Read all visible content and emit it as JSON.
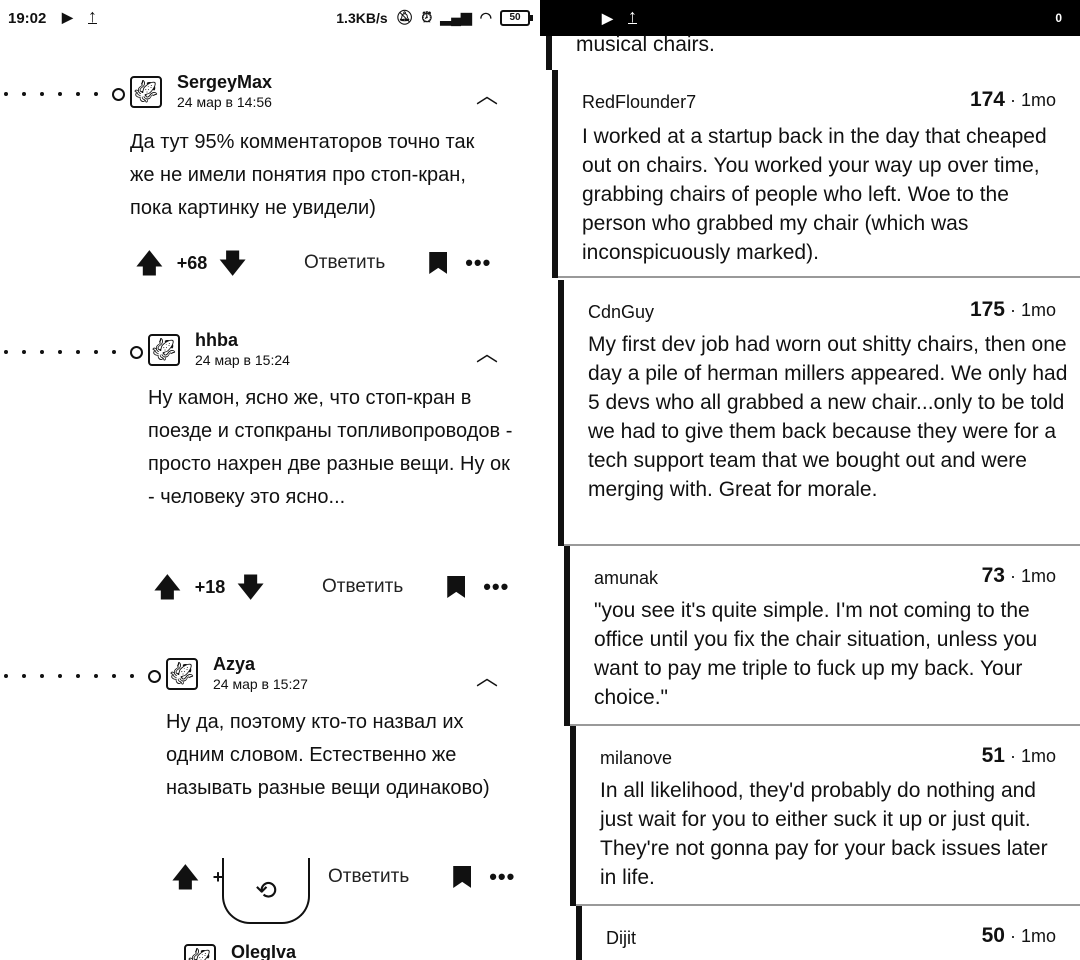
{
  "left": {
    "status": {
      "time": "19:02",
      "speed": "1.3KB/s",
      "battery": "50"
    },
    "comments": [
      {
        "author": "SergeyMax",
        "date": "24 мар в 14:56",
        "body": "Да тут 95% комментаторов точно так же не имели понятия про стоп-кран, пока картинку не увидели)",
        "votes": "+68",
        "reply": "Ответить"
      },
      {
        "author": "hhba",
        "date": "24 мар в 15:24",
        "body": "Ну камон, ясно же, что стоп-кран в поезде и стопкраны топливопроводов - просто нахрен две разные вещи. Ну ок - человеку это ясно...",
        "votes": "+18",
        "reply": "Ответить"
      },
      {
        "author": "Azya",
        "date": "24 мар в 15:27",
        "body": "Ну да, поэтому кто-то назвал их одним словом. Естественно же называть разные вещи одинаково)",
        "votes": "+9",
        "reply": "Ответить"
      },
      {
        "author": "OlegIva"
      }
    ]
  },
  "right": {
    "status": {
      "notif_count": "0"
    },
    "prev_tail": "musical chairs.",
    "comments": [
      {
        "user": "RedFlounder7",
        "score": "174",
        "age": "1mo",
        "body": "I worked at a startup back in the day that cheaped out on chairs. You worked your way up over time, grabbing chairs of people who left. Woe to the person who grabbed my chair (which was inconspicuously marked)."
      },
      {
        "user": "CdnGuy",
        "score": "175",
        "age": "1mo",
        "body": "My first dev job had worn out shitty chairs, then one day a pile of herman millers appeared. We only had 5 devs who all grabbed a new chair...only to be told we had to give them back because they were for a tech support team that we bought out and were merging with. Great for morale."
      },
      {
        "user": "amunak",
        "score": "73",
        "age": "1mo",
        "body": "\"you see it's quite simple. I'm not coming to the office until you fix the chair situation, unless you want to pay me triple to fuck up my back. Your choice.\""
      },
      {
        "user": "milanove",
        "score": "51",
        "age": "1mo",
        "body": "In all likelihood, they'd probably do nothing and just wait for you to either suck it up or just quit. They're not gonna pay for your back issues later in life."
      },
      {
        "user": "Dijit",
        "score": "50",
        "age": "1mo",
        "body": ""
      }
    ]
  }
}
